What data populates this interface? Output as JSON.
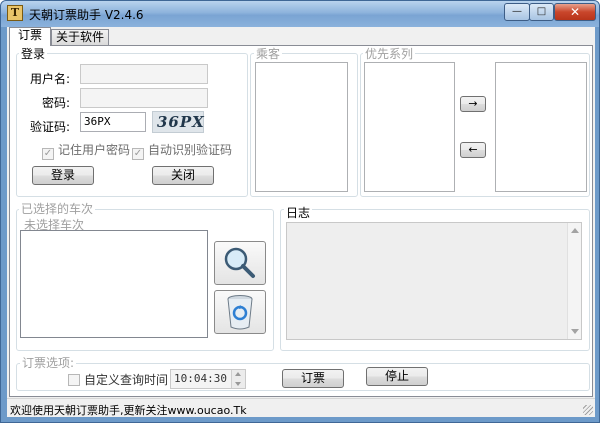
{
  "window": {
    "title": "天朝订票助手 V2.4.6",
    "icon_letter": "T",
    "minimize_glyph": "—",
    "maximize_glyph": "□",
    "close_glyph": "✕"
  },
  "tabs": [
    {
      "label": "订票"
    },
    {
      "label": "关于软件"
    }
  ],
  "login": {
    "group_title": "登录",
    "username_label": "用户名:",
    "username_value": "",
    "password_label": "密码:",
    "password_value": "",
    "captcha_label": "验证码:",
    "captcha_value": "36PX",
    "captcha_image_text": "36PX",
    "remember_label": "记住用户密码",
    "auto_captcha_label": "自动识别验证码",
    "check_glyph": "✓",
    "login_button": "登录",
    "close_button": "关闭"
  },
  "passengers": {
    "group_title": "乘客"
  },
  "priority": {
    "group_title": "优先系列",
    "move_right": "→",
    "move_left": "←"
  },
  "selected_trains": {
    "group_title": "已选择的车次",
    "placeholder": "未选择车次",
    "search_icon": "magnifier-icon",
    "recycle_icon": "recycle-bin-icon"
  },
  "log": {
    "group_title": "日志"
  },
  "options": {
    "group_title": "订票选项:",
    "custom_time_label": "自定义查询时间",
    "time_value": "10:04:30",
    "book_button": "订票",
    "stop_button": "停止"
  },
  "statusbar": {
    "text": "欢迎使用天朝订票助手,更新关注www.oucao.Tk"
  },
  "colors": {
    "titlebar": "#8db3dc",
    "close_button": "#c9462b",
    "panel_bg": "#ffffff",
    "window_bg": "#f0f0f0"
  }
}
